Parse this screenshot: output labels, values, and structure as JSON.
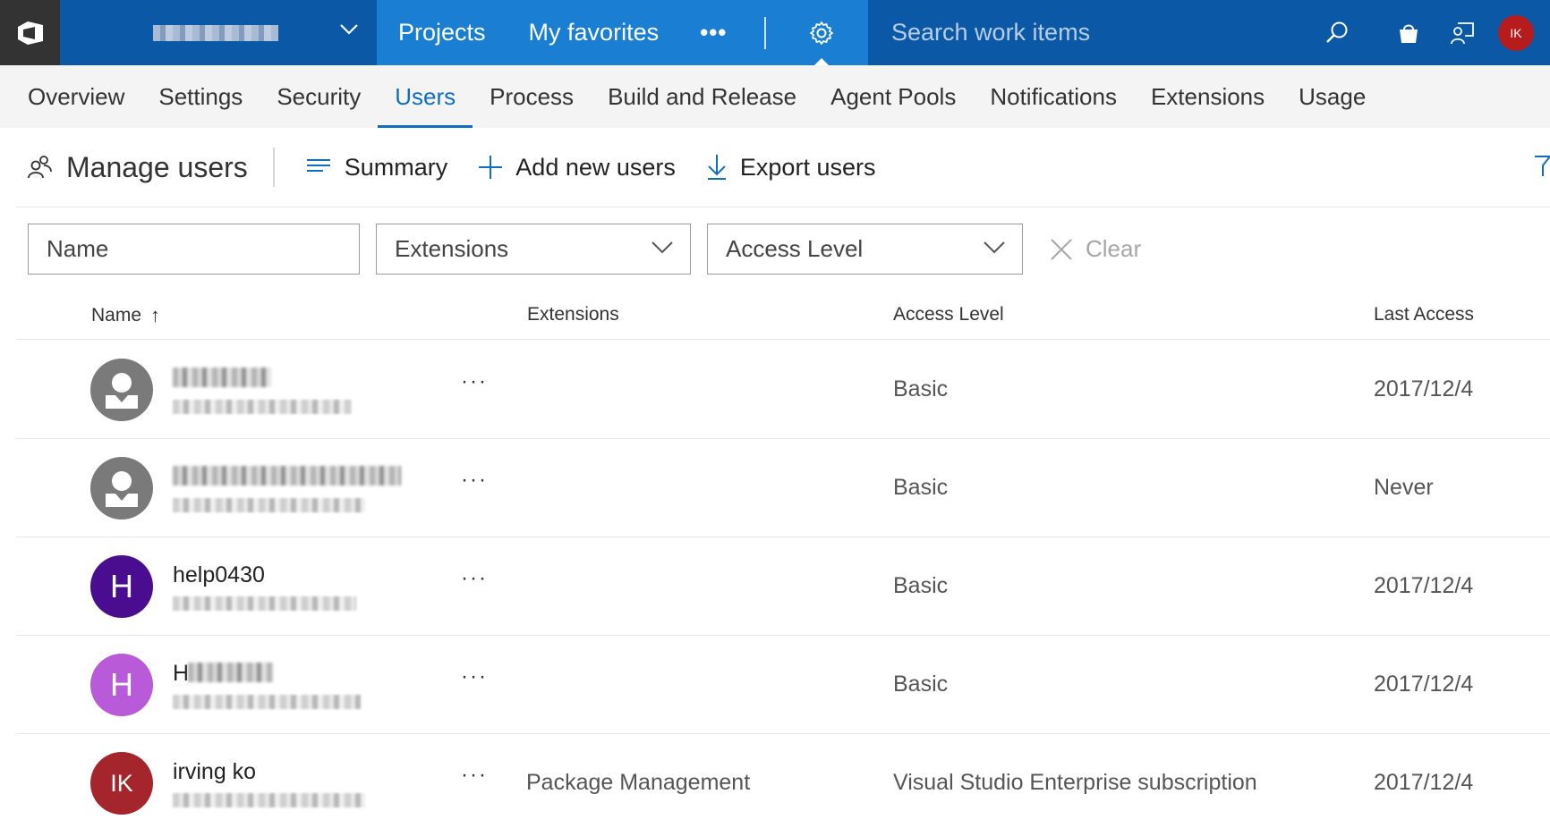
{
  "topbar": {
    "nav": [
      "Projects",
      "My favorites"
    ],
    "more": "•••",
    "search_placeholder": "Search work items",
    "user_initials": "IK"
  },
  "tabs": [
    {
      "label": "Overview"
    },
    {
      "label": "Settings"
    },
    {
      "label": "Security"
    },
    {
      "label": "Users",
      "active": true
    },
    {
      "label": "Process"
    },
    {
      "label": "Build and Release"
    },
    {
      "label": "Agent Pools"
    },
    {
      "label": "Notifications"
    },
    {
      "label": "Extensions"
    },
    {
      "label": "Usage"
    }
  ],
  "toolbar": {
    "title": "Manage users",
    "summary": "Summary",
    "add": "Add new users",
    "export": "Export users"
  },
  "filters": {
    "name_placeholder": "Name",
    "extensions": "Extensions",
    "access_level": "Access Level",
    "clear": "Clear"
  },
  "table": {
    "headers": {
      "name": "Name",
      "sort_arrow": "↑",
      "extensions": "Extensions",
      "access": "Access Level",
      "last": "Last Access"
    },
    "rows": [
      {
        "name": "",
        "initials": "",
        "avatar": "generic",
        "extensions": "",
        "access": "Basic",
        "last_access": "2017/12/4"
      },
      {
        "name": "",
        "initials": "",
        "avatar": "generic",
        "extensions": "",
        "access": "Basic",
        "last_access": "Never"
      },
      {
        "name": "help0430",
        "initials": "H",
        "avatar": "#4b0d8f",
        "extensions": "",
        "access": "Basic",
        "last_access": "2017/12/4"
      },
      {
        "name": "H",
        "initials": "H",
        "avatar": "#b95ad8",
        "extensions": "",
        "access": "Basic",
        "last_access": "2017/12/4"
      },
      {
        "name": "irving ko",
        "initials": "IK",
        "avatar": "#a4262c",
        "extensions": "Package Management",
        "access": "Visual Studio Enterprise subscription",
        "last_access": "2017/12/4"
      }
    ],
    "more": "···"
  },
  "colors": {
    "accent": "#106ebe",
    "topbar_dark": "#0b59a6",
    "topbar_mid": "#1a7fd3"
  }
}
